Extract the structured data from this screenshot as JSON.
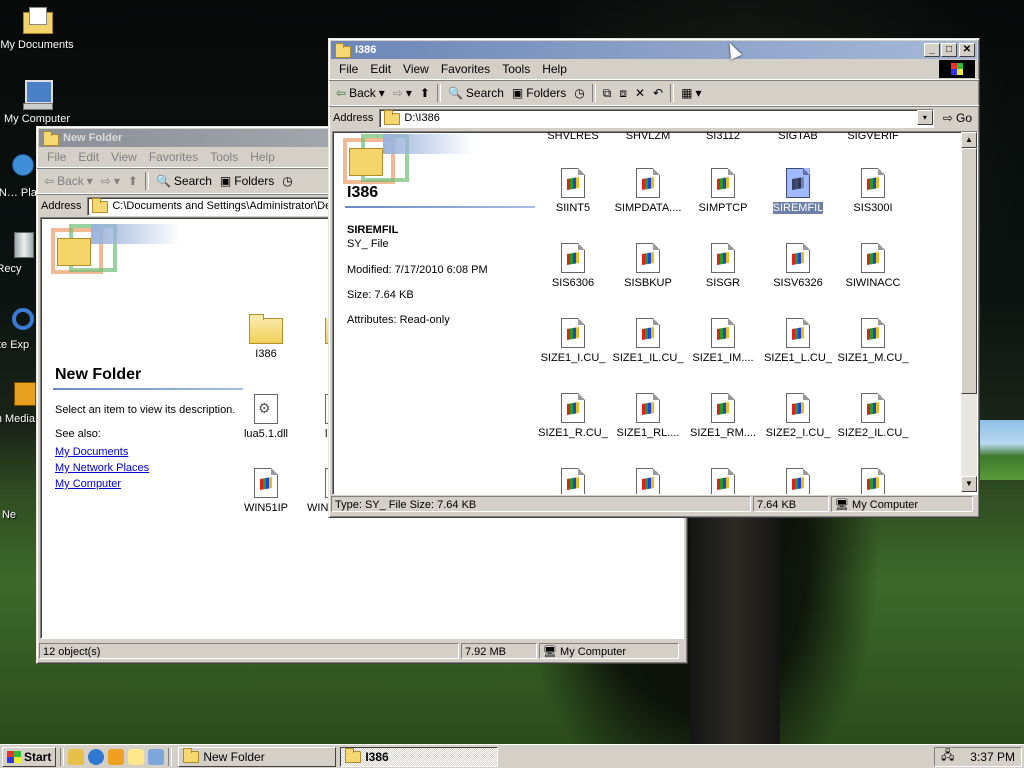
{
  "desktop": {
    "icons": [
      {
        "label": "My Documents"
      },
      {
        "label": "My Computer"
      },
      {
        "label": "My N… Pla"
      },
      {
        "label": "Recy"
      },
      {
        "label": "Inte Exp"
      },
      {
        "label": "Win Media"
      },
      {
        "label": "Ne"
      }
    ]
  },
  "new_folder_window": {
    "title": "New Folder",
    "menu": [
      "File",
      "Edit",
      "View",
      "Favorites",
      "Tools",
      "Help"
    ],
    "toolbar": {
      "back": "Back",
      "search": "Search",
      "folders": "Folders"
    },
    "address_label": "Address",
    "address": "C:\\Documents and Settings\\Administrator\\Des",
    "panel": {
      "title": "New Folder",
      "hint": "Select an item to view its description.",
      "see_also": "See also:",
      "links": [
        "My Documents",
        "My Network Places",
        "My Computer"
      ]
    },
    "files": [
      {
        "name": "I386",
        "type": "folder"
      },
      {
        "name": "lua5.1.dll",
        "type": "dll"
      },
      {
        "name": "lu",
        "type": "dll"
      },
      {
        "name": "WIN51IP",
        "type": "setup"
      },
      {
        "name": "WIN",
        "type": "setup"
      }
    ],
    "status": {
      "objects": "12 object(s)",
      "size": "7.92 MB",
      "zone": "My Computer"
    }
  },
  "i386_window": {
    "title": "I386",
    "menu": [
      "File",
      "Edit",
      "View",
      "Favorites",
      "Tools",
      "Help"
    ],
    "toolbar": {
      "back": "Back",
      "search": "Search",
      "folders": "Folders"
    },
    "address_label": "Address",
    "address": "D:\\I386",
    "go": "Go",
    "panel": {
      "title": "I386",
      "selected_name": "SIREMFIL",
      "selected_type": "SY_ File",
      "modified": "Modified: 7/17/2010 6:08 PM",
      "size": "Size: 7.64 KB",
      "attributes": "Attributes: Read-only"
    },
    "top_partial_row": [
      "SHVLRES",
      "SHVLZM",
      "SI3112",
      "SIGTAB",
      "SIGVERIF"
    ],
    "files": [
      "SIINT5",
      "SIMPDATA....",
      "SIMPTCP",
      "SIREMFIL",
      "SIS300I",
      "SIS6306",
      "SISBKUP",
      "SISGR",
      "SISV6326",
      "SIWINACC",
      "SIZE1_I.CU_",
      "SIZE1_IL.CU_",
      "SIZE1_IM....",
      "SIZE1_L.CU_",
      "SIZE1_M.CU_",
      "SIZE1_R.CU_",
      "SIZE1_RL....",
      "SIZE1_RM....",
      "SIZE2_I.CU_",
      "SIZE2_IL.CU_"
    ],
    "selected": "SIREMFIL",
    "status": {
      "info": "Type: SY_ File Size: 7.64 KB",
      "size": "7.64 KB",
      "zone": "My Computer"
    }
  },
  "taskbar": {
    "start": "Start",
    "tasks": [
      {
        "label": "New Folder",
        "active": false
      },
      {
        "label": "I386",
        "active": true
      }
    ],
    "clock": "3:37 PM"
  }
}
